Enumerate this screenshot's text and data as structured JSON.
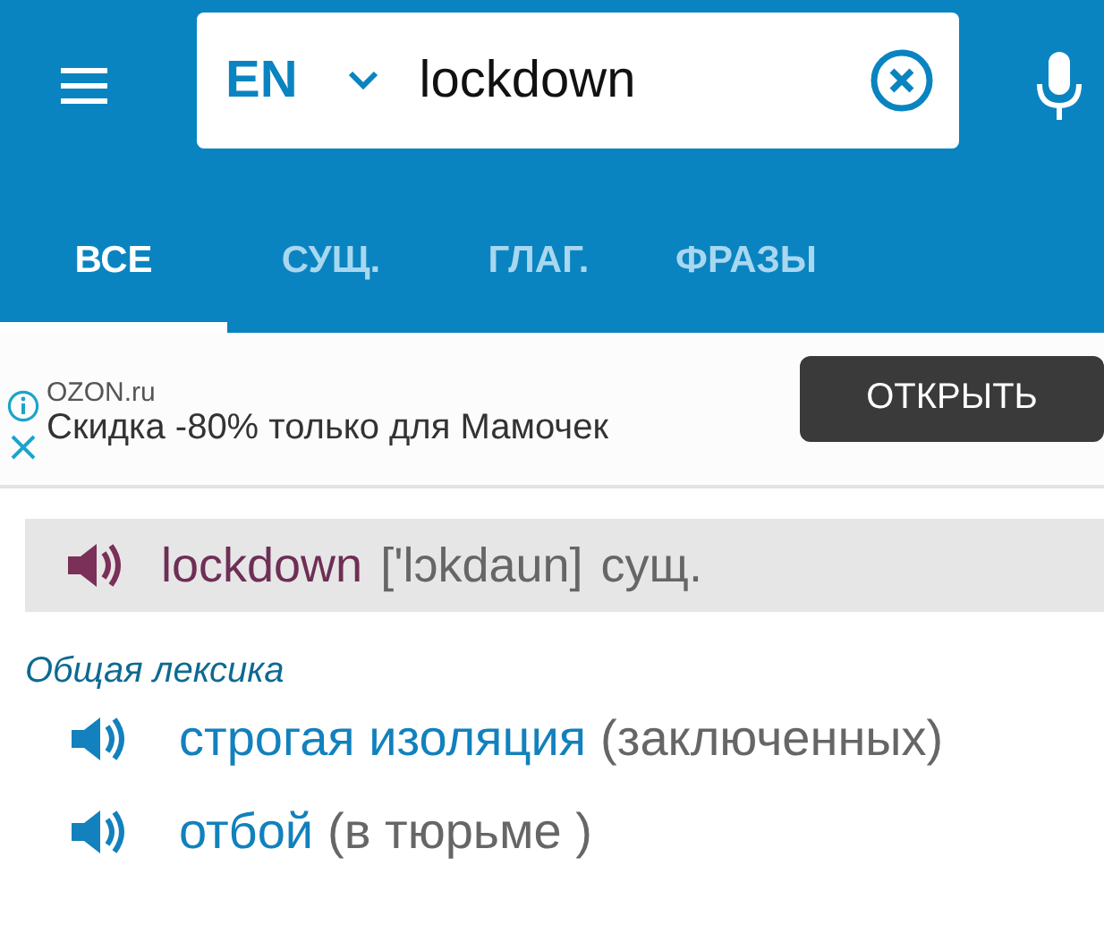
{
  "search": {
    "language": "EN",
    "value": "lockdown"
  },
  "tabs": [
    {
      "label": "ВСЕ",
      "selected": true
    },
    {
      "label": "СУЩ.",
      "selected": false
    },
    {
      "label": "ГЛАГ.",
      "selected": false
    },
    {
      "label": "ФРАЗЫ",
      "selected": false
    }
  ],
  "ad": {
    "advertiser": "OZON.ru",
    "text": "Скидка -80% только для Мамочек",
    "button": "ОТКРЫТЬ"
  },
  "entry": {
    "word": "lockdown",
    "transcription": "['lɔkdaun]",
    "part_of_speech": "сущ."
  },
  "category": "Общая лексика",
  "translations": [
    {
      "term": "строгая изоляция",
      "note": "(заключенных)"
    },
    {
      "term": "отбой",
      "note": "(в тюрьме )"
    }
  ]
}
